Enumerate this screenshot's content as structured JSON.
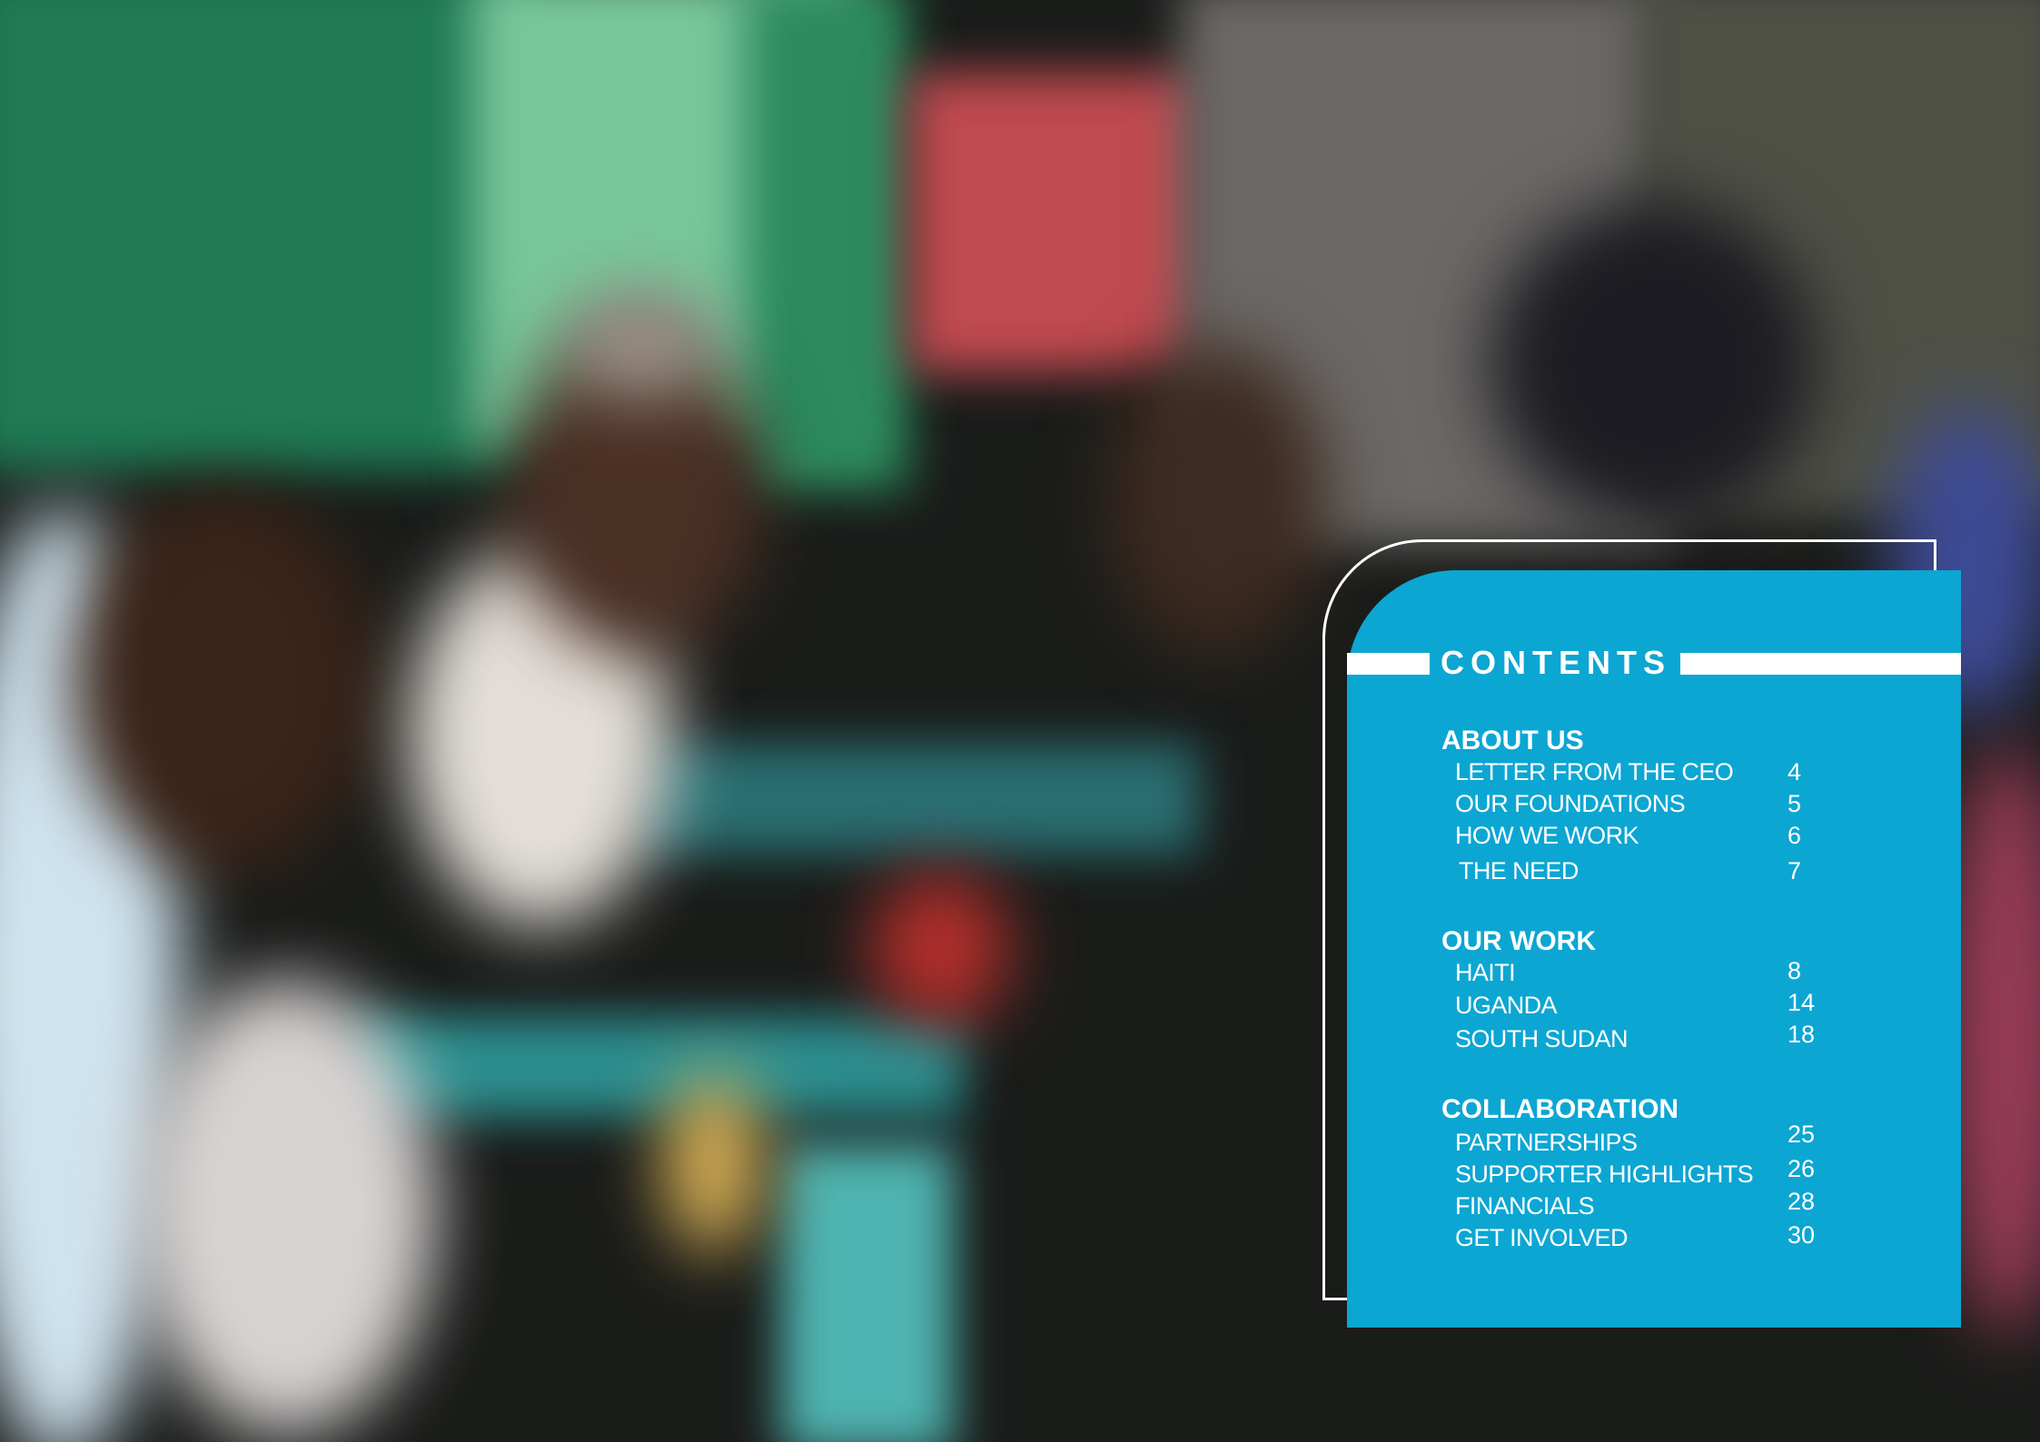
{
  "contents": {
    "title": "CONTENTS",
    "sections": [
      {
        "heading": "ABOUT US",
        "items": [
          {
            "label": "LETTER FROM THE CEO",
            "page": "4"
          },
          {
            "label": "OUR FOUNDATIONS",
            "page": "5"
          },
          {
            "label": "HOW WE WORK",
            "page": "6"
          },
          {
            "label": "THE NEED",
            "page": "7"
          }
        ]
      },
      {
        "heading": "OUR WORK",
        "items": [
          {
            "label": "HAITI",
            "page": "8"
          },
          {
            "label": "UGANDA",
            "page": "14"
          },
          {
            "label": "SOUTH SUDAN",
            "page": "18"
          }
        ]
      },
      {
        "heading": "COLLABORATION",
        "items": [
          {
            "label": "PARTNERSHIPS",
            "page": "25"
          },
          {
            "label": "SUPPORTER HIGHLIGHTS",
            "page": "26"
          },
          {
            "label": "FINANCIALS",
            "page": "28"
          },
          {
            "label": "GET INVOLVED",
            "page": "30"
          }
        ]
      }
    ]
  },
  "colors": {
    "panel": "#0ca6d3",
    "text": "#ffffff"
  }
}
